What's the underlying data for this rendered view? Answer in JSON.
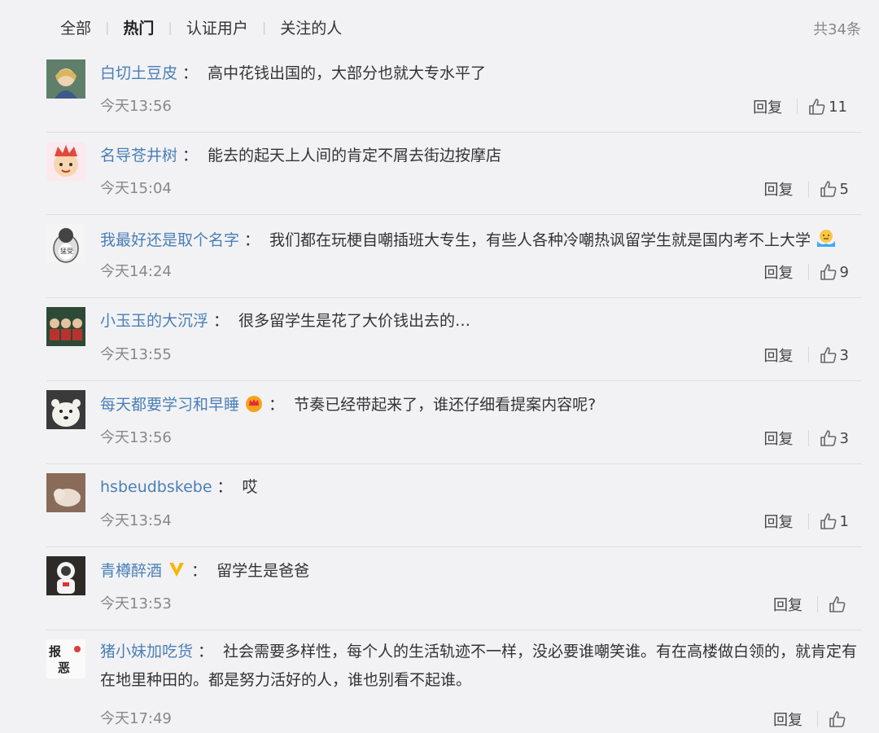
{
  "filter": {
    "tabs": [
      "全部",
      "热门",
      "认证用户",
      "关注的人"
    ],
    "active_tab": 1,
    "total": "共34条"
  },
  "colors": {
    "name": "#4a7fb5",
    "background": "#f2f2f5",
    "divider": "#dedede"
  },
  "comments": [
    {
      "user": "白切土豆皮",
      "text": "高中花钱出国的，大部分也就大专水平了",
      "time": "今天13:56",
      "reply": "回复",
      "likes": "11",
      "avatar": "anime-elf-avatar"
    },
    {
      "user": "名导苍井树",
      "text": "能去的起天上人间的肯定不屑去街边按摩店",
      "time": "今天15:04",
      "reply": "回复",
      "likes": "5",
      "avatar": "cartoon-king-avatar"
    },
    {
      "user": "我最好还是取个名字",
      "text": "我们都在玩梗自嘲插班大专生，有些人各种冷嘲热讽留学生就是国内考不上大学",
      "time": "今天14:24",
      "reply": "回复",
      "likes": "9",
      "avatar": "penguin-avatar",
      "emoji": "shrug-emoji"
    },
    {
      "user": "小玉玉的大沉浮",
      "text": "很多留学生是花了大价钱出去的…",
      "time": "今天13:55",
      "reply": "回复",
      "likes": "3",
      "avatar": "group-photo-avatar"
    },
    {
      "user": "每天都要学习和早睡",
      "text": "节奏已经带起来了，谁还仔细看提案内容呢?",
      "time": "今天13:56",
      "reply": "回复",
      "likes": "3",
      "avatar": "polar-bear-avatar",
      "badge": "crown-badge"
    },
    {
      "user": "hsbeudbskebe",
      "text": "哎",
      "time": "今天13:54",
      "reply": "回复",
      "likes": "1",
      "avatar": "pet-photo-avatar"
    },
    {
      "user": "青樽醉酒",
      "text": "留学生是爸爸",
      "time": "今天13:53",
      "reply": "回复",
      "likes": "",
      "avatar": "astronaut-avatar",
      "badge": "verified-v-badge"
    },
    {
      "user": "猪小妹加吃货",
      "text": "社会需要多样性，每个人的生活轨迹不一样，没必要谁嘲笑谁。有在高楼做白领的，就肯定有在地里种田的。都是努力活好的人，谁也别看不起谁。",
      "time": "今天17:49",
      "reply": "回复",
      "likes": "",
      "avatar": "calligraphy-avatar"
    }
  ]
}
